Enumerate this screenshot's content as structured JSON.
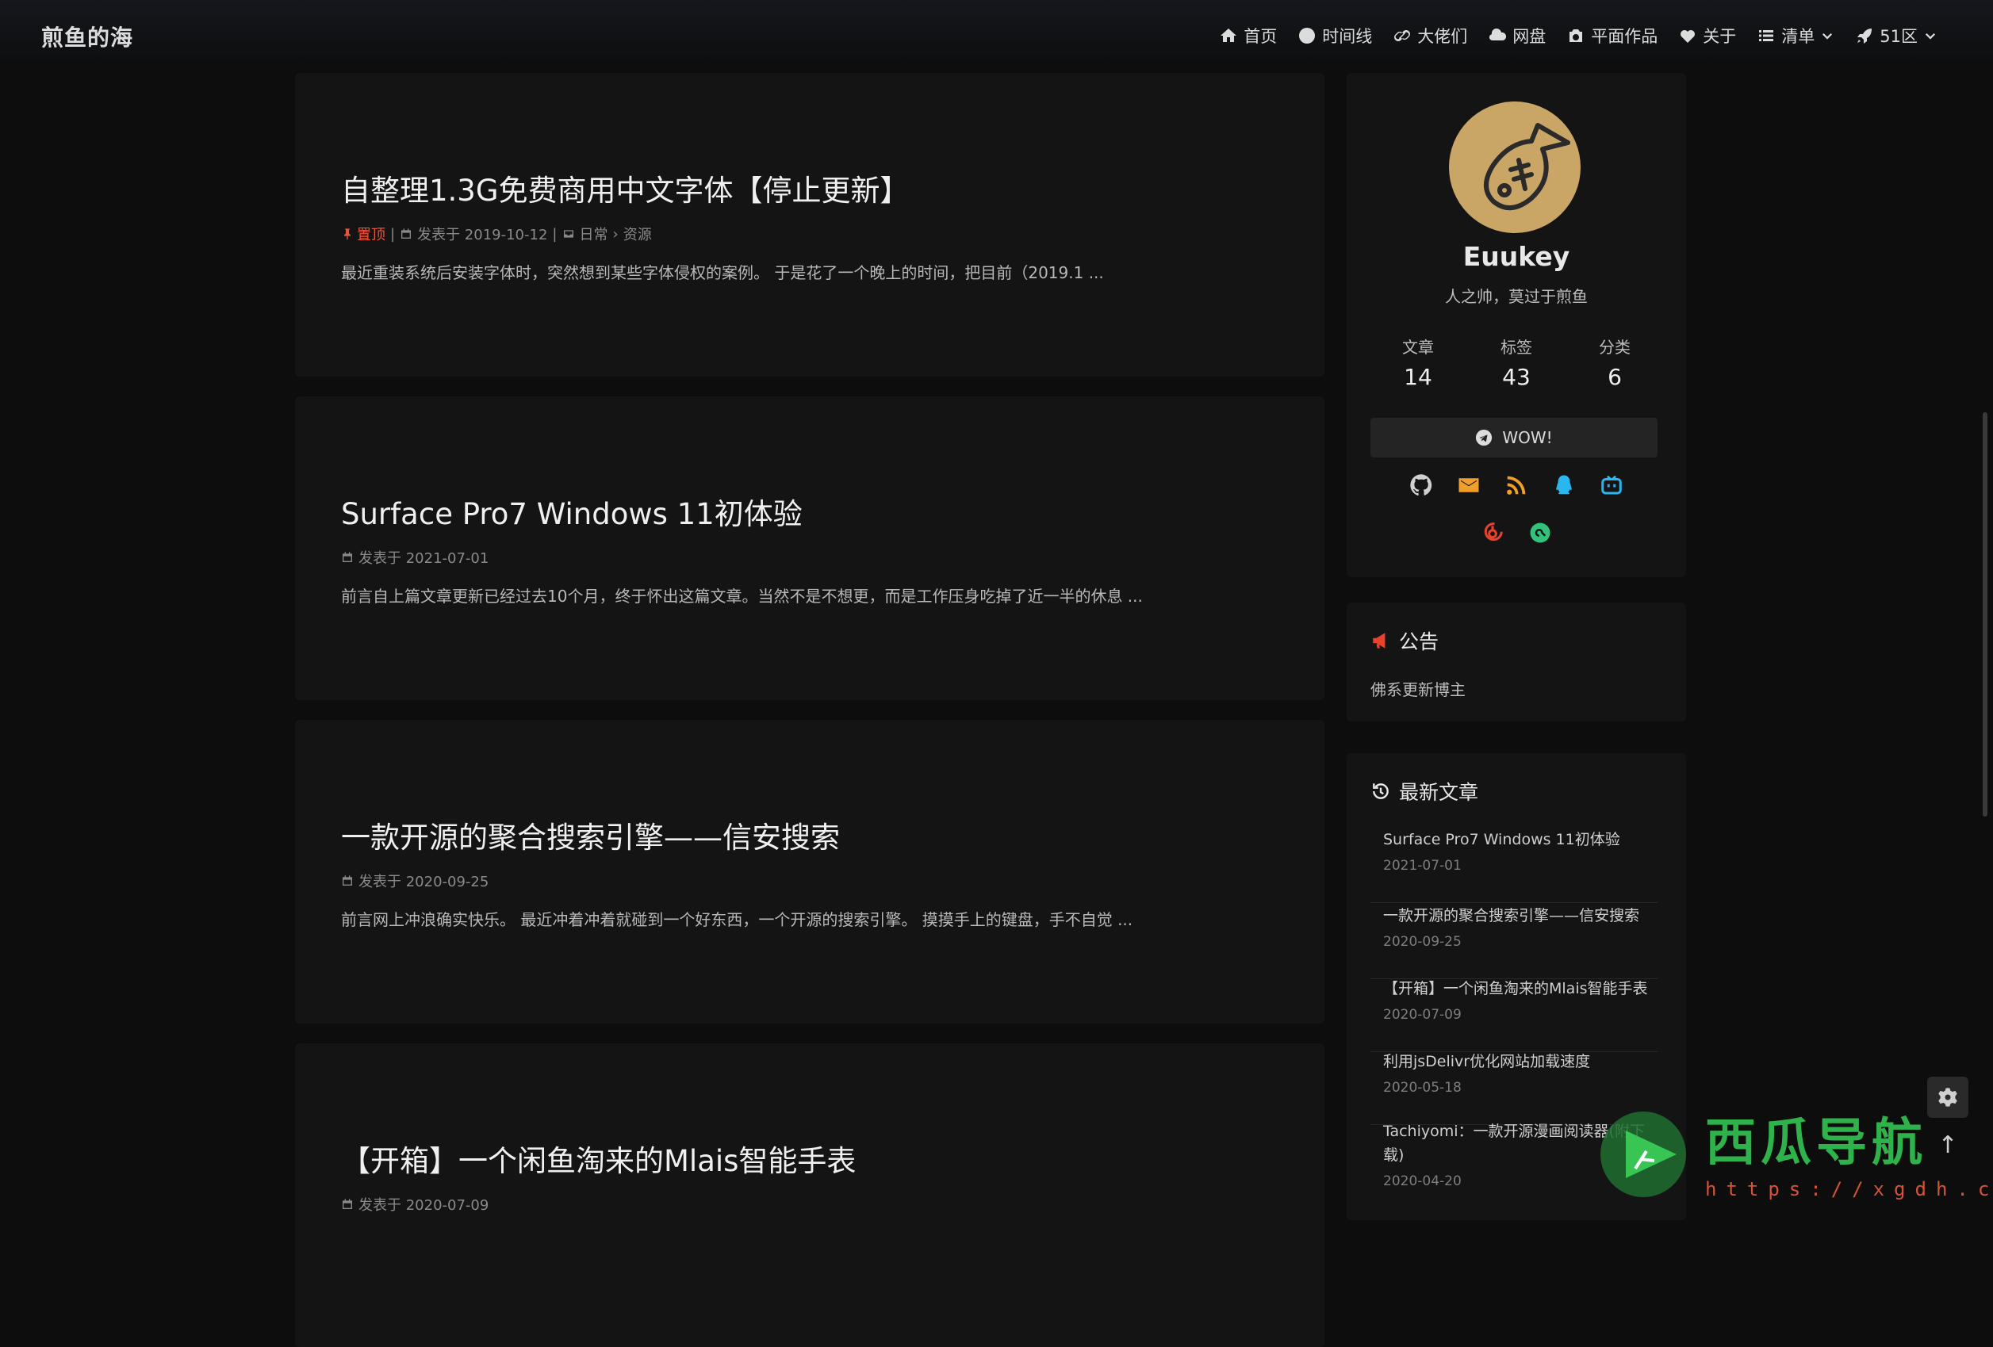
{
  "site": {
    "brand": "煎鱼的海"
  },
  "nav": [
    {
      "label": "首页",
      "icon": "home-icon"
    },
    {
      "label": "时间线",
      "icon": "clock-icon"
    },
    {
      "label": "大佬们",
      "icon": "link-icon"
    },
    {
      "label": "网盘",
      "icon": "cloud-icon"
    },
    {
      "label": "平面作品",
      "icon": "camera-icon"
    },
    {
      "label": "关于",
      "icon": "heart-icon"
    },
    {
      "label": "清单",
      "icon": "list-icon"
    },
    {
      "label": "51区",
      "icon": "rocket-icon"
    }
  ],
  "posts": [
    {
      "title": "自整理1.3G免费商用中文字体【停止更新】",
      "pinned_label": "置顶",
      "date": "发表于 2019-10-12",
      "category": "日常",
      "subcategory": "资源",
      "excerpt": "最近重装系统后安装字体时，突然想到某些字体侵权的案例。 于是花了一个晚上的时间，把目前（2019.1 ..."
    },
    {
      "title": "Surface Pro7 Windows 11初体验",
      "date": "发表于 2021-07-01",
      "excerpt": "前言自上篇文章更新已经过去10个月，终于怀出这篇文章。当然不是不想更，而是工作压身吃掉了近一半的休息 ..."
    },
    {
      "title": "一款开源的聚合搜索引擎——信安搜索",
      "date": "发表于 2020-09-25",
      "excerpt": "前言网上冲浪确实快乐。 最近冲着冲着就碰到一个好东西，一个开源的搜索引擎。 摸摸手上的键盘，手不自觉 ..."
    },
    {
      "title": "【开箱】一个闲鱼淘来的Mlais智能手表",
      "date": "发表于 2020-07-09",
      "excerpt": ""
    }
  ],
  "author": {
    "name": "Euukey",
    "description": "人之帅，莫过于煎鱼",
    "stats": [
      {
        "label": "文章",
        "value": "14"
      },
      {
        "label": "标签",
        "value": "43"
      },
      {
        "label": "分类",
        "value": "6"
      }
    ],
    "button_label": "WOW!",
    "social": [
      "github-icon",
      "email-icon",
      "rss-icon",
      "qq-icon",
      "bilibili-icon",
      "netease-music-icon",
      "qq-music-icon"
    ]
  },
  "notice": {
    "heading": "公告",
    "text": "佛系更新博主"
  },
  "recent": {
    "heading": "最新文章",
    "items": [
      {
        "title": "Surface Pro7 Windows 11初体验",
        "date": "2021-07-01"
      },
      {
        "title": "一款开源的聚合搜索引擎——信安搜索",
        "date": "2020-09-25"
      },
      {
        "title": "【开箱】一个闲鱼淘来的Mlais智能手表",
        "date": "2020-07-09"
      },
      {
        "title": "利用jsDelivr优化网站加载速度",
        "date": "2020-05-18"
      },
      {
        "title": "Tachiyomi：一款开源漫画阅读器(附下载)",
        "date": "2020-04-20"
      }
    ]
  },
  "watermark": {
    "text": "西瓜导航",
    "url": "https://xgdh.cn"
  },
  "colors": {
    "background": "#0d0d0d",
    "card": "#141414",
    "accent": "#e7553c",
    "watermark": "#2fb24b"
  }
}
